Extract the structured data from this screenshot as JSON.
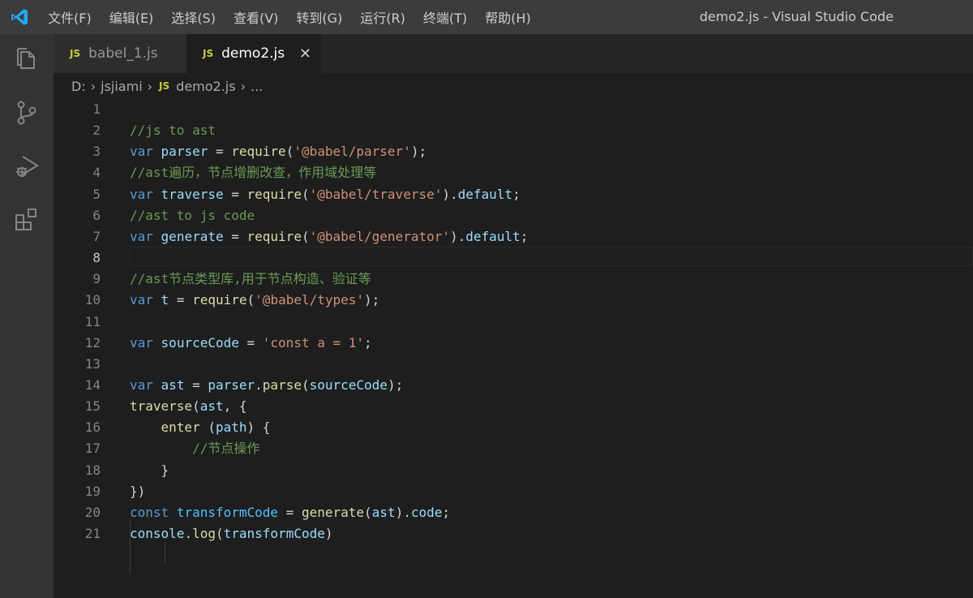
{
  "window": {
    "title": "demo2.js - Visual Studio Code"
  },
  "menu": [
    "文件(F)",
    "编辑(E)",
    "选择(S)",
    "查看(V)",
    "转到(G)",
    "运行(R)",
    "终端(T)",
    "帮助(H)"
  ],
  "tabs": [
    {
      "badge": "JS",
      "label": "babel_1.js",
      "active": false
    },
    {
      "badge": "JS",
      "label": "demo2.js",
      "active": true,
      "close": "✕"
    }
  ],
  "breadcrumb": {
    "drive": "D:",
    "folder": "jsjiami",
    "badge": "JS",
    "file": "demo2.js",
    "more": "..."
  },
  "editor": {
    "current_line": 8,
    "lines": [
      {
        "n": "1",
        "tokens": []
      },
      {
        "n": "2",
        "tokens": [
          [
            "cm",
            "//js to ast"
          ]
        ]
      },
      {
        "n": "3",
        "tokens": [
          [
            "kw",
            "var"
          ],
          [
            "pl",
            " "
          ],
          [
            "var",
            "parser"
          ],
          [
            "pl",
            " = "
          ],
          [
            "fn",
            "require"
          ],
          [
            "pl",
            "("
          ],
          [
            "str",
            "'@babel/parser'"
          ],
          [
            "pl",
            ");"
          ]
        ]
      },
      {
        "n": "4",
        "tokens": [
          [
            "cm",
            "//ast遍历，节点增删改查，作用域处理等"
          ]
        ]
      },
      {
        "n": "5",
        "tokens": [
          [
            "kw",
            "var"
          ],
          [
            "pl",
            " "
          ],
          [
            "var",
            "traverse"
          ],
          [
            "pl",
            " = "
          ],
          [
            "fn",
            "require"
          ],
          [
            "pl",
            "("
          ],
          [
            "str",
            "'@babel/traverse'"
          ],
          [
            "pl",
            ")."
          ],
          [
            "var",
            "default"
          ],
          [
            "pl",
            ";"
          ]
        ]
      },
      {
        "n": "6",
        "tokens": [
          [
            "cm",
            "//ast to js code"
          ]
        ]
      },
      {
        "n": "7",
        "tokens": [
          [
            "kw",
            "var"
          ],
          [
            "pl",
            " "
          ],
          [
            "var",
            "generate"
          ],
          [
            "pl",
            " = "
          ],
          [
            "fn",
            "require"
          ],
          [
            "pl",
            "("
          ],
          [
            "str",
            "'@babel/generator'"
          ],
          [
            "pl",
            ")."
          ],
          [
            "var",
            "default"
          ],
          [
            "pl",
            ";"
          ]
        ]
      },
      {
        "n": "8",
        "tokens": []
      },
      {
        "n": "9",
        "tokens": [
          [
            "cm",
            "//ast节点类型库,用于节点构造、验证等"
          ]
        ]
      },
      {
        "n": "10",
        "tokens": [
          [
            "kw",
            "var"
          ],
          [
            "pl",
            " "
          ],
          [
            "var",
            "t"
          ],
          [
            "pl",
            " = "
          ],
          [
            "fn",
            "require"
          ],
          [
            "pl",
            "("
          ],
          [
            "str",
            "'@babel/types'"
          ],
          [
            "pl",
            ");"
          ]
        ]
      },
      {
        "n": "11",
        "tokens": []
      },
      {
        "n": "12",
        "tokens": [
          [
            "kw",
            "var"
          ],
          [
            "pl",
            " "
          ],
          [
            "var",
            "sourceCode"
          ],
          [
            "pl",
            " = "
          ],
          [
            "str",
            "'const a = 1'"
          ],
          [
            "pl",
            ";"
          ]
        ]
      },
      {
        "n": "13",
        "tokens": []
      },
      {
        "n": "14",
        "tokens": [
          [
            "kw",
            "var"
          ],
          [
            "pl",
            " "
          ],
          [
            "var",
            "ast"
          ],
          [
            "pl",
            " = "
          ],
          [
            "var",
            "parser"
          ],
          [
            "pl",
            "."
          ],
          [
            "fn",
            "parse"
          ],
          [
            "pl",
            "("
          ],
          [
            "var",
            "sourceCode"
          ],
          [
            "pl",
            ");"
          ]
        ]
      },
      {
        "n": "15",
        "tokens": [
          [
            "fn",
            "traverse"
          ],
          [
            "pl",
            "("
          ],
          [
            "var",
            "ast"
          ],
          [
            "pl",
            ", {"
          ]
        ]
      },
      {
        "n": "16",
        "tokens": [
          [
            "pl",
            "    "
          ],
          [
            "fn",
            "enter"
          ],
          [
            "pl",
            " ("
          ],
          [
            "var",
            "path"
          ],
          [
            "pl",
            ") {"
          ]
        ]
      },
      {
        "n": "17",
        "tokens": [
          [
            "pl",
            "        "
          ],
          [
            "cm",
            "//节点操作"
          ]
        ]
      },
      {
        "n": "18",
        "tokens": [
          [
            "pl",
            "    }"
          ]
        ]
      },
      {
        "n": "19",
        "tokens": [
          [
            "pl",
            "})"
          ]
        ]
      },
      {
        "n": "20",
        "tokens": [
          [
            "kw",
            "const"
          ],
          [
            "pl",
            " "
          ],
          [
            "con",
            "transformCode"
          ],
          [
            "pl",
            " = "
          ],
          [
            "fn",
            "generate"
          ],
          [
            "pl",
            "("
          ],
          [
            "var",
            "ast"
          ],
          [
            "pl",
            ")."
          ],
          [
            "var",
            "code"
          ],
          [
            "pl",
            ";"
          ]
        ]
      },
      {
        "n": "21",
        "tokens": [
          [
            "var",
            "console"
          ],
          [
            "pl",
            "."
          ],
          [
            "fn",
            "log"
          ],
          [
            "pl",
            "("
          ],
          [
            "var",
            "transformCode"
          ],
          [
            "pl",
            ")"
          ]
        ]
      }
    ]
  }
}
